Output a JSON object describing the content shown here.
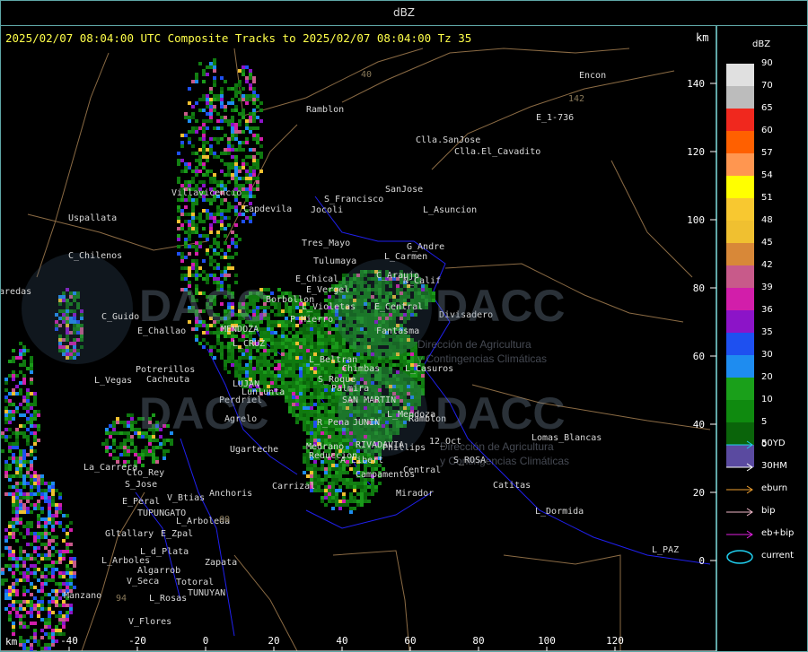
{
  "window": {
    "title": "dBZ"
  },
  "header": {
    "text": "2025/02/07 08:04:00 UTC Composite Tracks to 2025/02/07 08:04:00 Tz 35",
    "km_label": "km"
  },
  "axes": {
    "x_unit": "km",
    "x_ticks": [
      "-40",
      "-20",
      "0",
      "20",
      "40",
      "60",
      "80",
      "100",
      "120"
    ],
    "y_ticks": [
      "140",
      "120",
      "100",
      "80",
      "60",
      "40",
      "20",
      "0"
    ]
  },
  "watermark": {
    "text1": "DACC",
    "sub1": "Dirección de Agricultura",
    "sub2": "y Contingencias Climáticas"
  },
  "places": [
    {
      "name": "Ramblon"
    },
    {
      "name": "Encon"
    },
    {
      "name": "E_1-736"
    },
    {
      "name": "Clla.SanJose"
    },
    {
      "name": "Clla.El_Cavadito"
    },
    {
      "name": "S_Francisco"
    },
    {
      "name": "SanJose"
    },
    {
      "name": "Jocoli"
    },
    {
      "name": "L_Asuncion"
    },
    {
      "name": "Villavicencio"
    },
    {
      "name": "Capdevila"
    },
    {
      "name": "Uspallata"
    },
    {
      "name": "Tres_Mayo"
    },
    {
      "name": "G_Andre"
    },
    {
      "name": "Tulumaya"
    },
    {
      "name": "L_Carmen"
    },
    {
      "name": "C_Chilenos"
    },
    {
      "name": "E_Chical"
    },
    {
      "name": "C_Araujo"
    },
    {
      "name": "E_Vergel"
    },
    {
      "name": "N_Calif"
    },
    {
      "name": "Paredas"
    },
    {
      "name": "Borbollon"
    },
    {
      "name": "L_Violetas"
    },
    {
      "name": "E_Central"
    },
    {
      "name": "C_Guido"
    },
    {
      "name": "P_Hierro"
    },
    {
      "name": "Divisadero"
    },
    {
      "name": "E_Challao"
    },
    {
      "name": "MENDOZA"
    },
    {
      "name": "Fantasma"
    },
    {
      "name": "L_CRUZ"
    },
    {
      "name": "Potrerillos"
    },
    {
      "name": "L_Beltran"
    },
    {
      "name": "Chimbas"
    },
    {
      "name": "L_Casuros"
    },
    {
      "name": "L_Vegas"
    },
    {
      "name": "Cacheuta"
    },
    {
      "name": "LUJAN"
    },
    {
      "name": "S_Roque"
    },
    {
      "name": "Palmira"
    },
    {
      "name": "Perdriel"
    },
    {
      "name": "Lunlunta"
    },
    {
      "name": "SAN MARTIN"
    },
    {
      "name": "Agrelo"
    },
    {
      "name": "L_Mendoza"
    },
    {
      "name": "R_Pena"
    },
    {
      "name": "JUNIN"
    },
    {
      "name": "Ramblon"
    },
    {
      "name": "Ugarteche"
    },
    {
      "name": "Medrano"
    },
    {
      "name": "RIVADAVIA"
    },
    {
      "name": "Phillips"
    },
    {
      "name": "12_Oct"
    },
    {
      "name": "Lomas_Blancas"
    },
    {
      "name": "La_Carrera"
    },
    {
      "name": "Reduccion"
    },
    {
      "name": "A_Libert"
    },
    {
      "name": "S_ROSA"
    },
    {
      "name": "Cto_Rey"
    },
    {
      "name": "Campamentos"
    },
    {
      "name": "Central"
    },
    {
      "name": "S_Jose"
    },
    {
      "name": "Catitas"
    },
    {
      "name": "E_Peral"
    },
    {
      "name": "V_Btias"
    },
    {
      "name": "Anchoris"
    },
    {
      "name": "Carrizal"
    },
    {
      "name": "Mirador"
    },
    {
      "name": "TUPUNGATO"
    },
    {
      "name": "L_Arboleda"
    },
    {
      "name": "L_Dormida"
    },
    {
      "name": "Gltallary"
    },
    {
      "name": "E_Zpal"
    },
    {
      "name": "L_d_Plata"
    },
    {
      "name": "L_PAZ"
    },
    {
      "name": "L_Arboles"
    },
    {
      "name": "Zapata"
    },
    {
      "name": "Algarrob"
    },
    {
      "name": "V_Seca"
    },
    {
      "name": "Totoral"
    },
    {
      "name": "Manzano"
    },
    {
      "name": "L_Rosas"
    },
    {
      "name": "TUNUYAN"
    },
    {
      "name": "V_Flores"
    },
    {
      "name": "142"
    },
    {
      "name": "94"
    },
    {
      "name": "40"
    },
    {
      "name": "60"
    }
  ],
  "legend": {
    "title": "dBZ",
    "levels": [
      {
        "label": "90",
        "color": "#e0e0e0"
      },
      {
        "label": "70",
        "color": "#bcbcbc"
      },
      {
        "label": "65",
        "color": "#f0281e"
      },
      {
        "label": "60",
        "color": "#ff6000"
      },
      {
        "label": "57",
        "color": "#ff9650"
      },
      {
        "label": "54",
        "color": "#ffff00"
      },
      {
        "label": "51",
        "color": "#f8c830"
      },
      {
        "label": "48",
        "color": "#f0c030"
      },
      {
        "label": "45",
        "color": "#d88838"
      },
      {
        "label": "42",
        "color": "#c85a8a"
      },
      {
        "label": "39",
        "color": "#d21eaa"
      },
      {
        "label": "36",
        "color": "#8c14c8"
      },
      {
        "label": "35",
        "color": "#1e50f0"
      },
      {
        "label": "30",
        "color": "#1e8cf0"
      },
      {
        "label": "20",
        "color": "#1aa01a"
      },
      {
        "label": "10",
        "color": "#0f8a0f"
      },
      {
        "label": "5",
        "color": "#0a640a"
      },
      {
        "label": "0",
        "color": "#5a4aa0"
      }
    ],
    "tracks": [
      {
        "label": "50YD",
        "color": "#20d0f0"
      },
      {
        "label": "30HM",
        "color": "#ffffff"
      },
      {
        "label": "eburn",
        "color": "#f0a030"
      },
      {
        "label": "bip",
        "color": "#f0b8c8"
      },
      {
        "label": "eb+bip",
        "color": "#e020e0"
      }
    ],
    "current": {
      "label": "current",
      "color": "#20d0f0"
    }
  }
}
